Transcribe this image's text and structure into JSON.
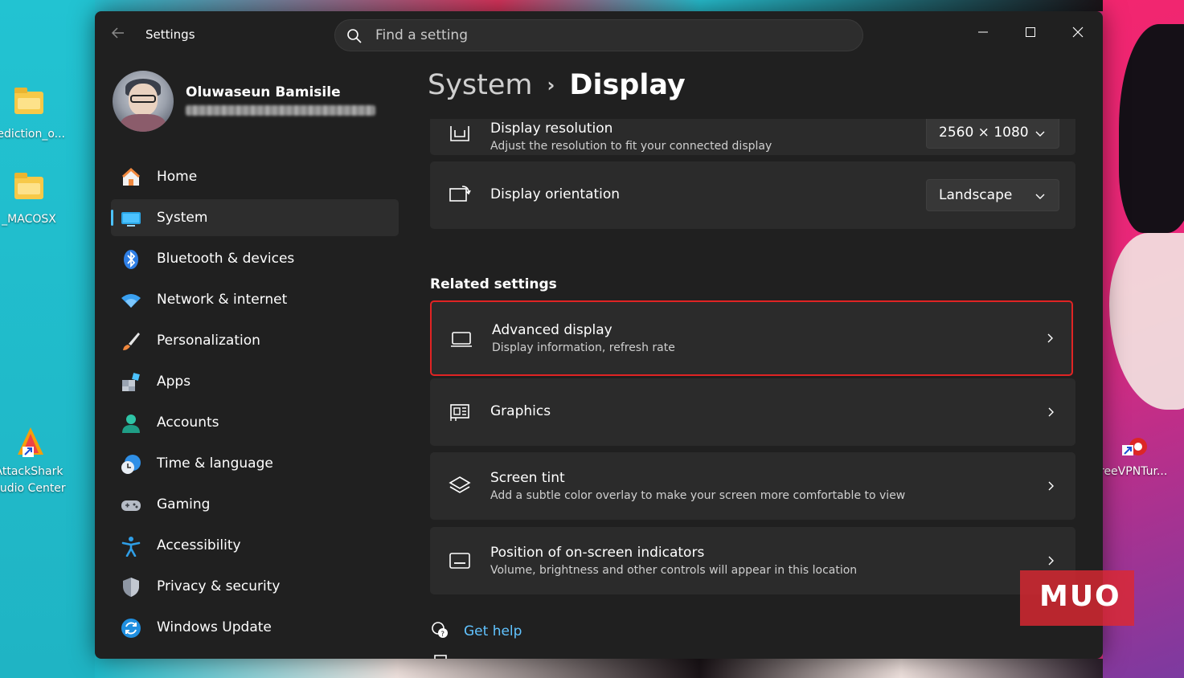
{
  "desktop": {
    "icons": [
      {
        "label": "rediction_o..."
      },
      {
        "label": "_MACOSX"
      },
      {
        "label": "AttackShark\nAudio Center"
      },
      {
        "label": "reeVPNTur..."
      }
    ],
    "watermark": "MUO"
  },
  "window": {
    "app_title": "Settings",
    "search_placeholder": "Find a setting"
  },
  "profile": {
    "name": "Oluwaseun Bamisile"
  },
  "nav": [
    {
      "label": "Home",
      "icon": "home-icon"
    },
    {
      "label": "System",
      "icon": "system-icon",
      "active": true
    },
    {
      "label": "Bluetooth & devices",
      "icon": "bluetooth-icon"
    },
    {
      "label": "Network & internet",
      "icon": "wifi-icon"
    },
    {
      "label": "Personalization",
      "icon": "brush-icon"
    },
    {
      "label": "Apps",
      "icon": "apps-icon"
    },
    {
      "label": "Accounts",
      "icon": "accounts-icon"
    },
    {
      "label": "Time & language",
      "icon": "clock-globe-icon"
    },
    {
      "label": "Gaming",
      "icon": "gamepad-icon"
    },
    {
      "label": "Accessibility",
      "icon": "accessibility-icon"
    },
    {
      "label": "Privacy & security",
      "icon": "shield-icon"
    },
    {
      "label": "Windows Update",
      "icon": "update-icon"
    }
  ],
  "breadcrumb": {
    "parent": "System",
    "separator": "›",
    "current": "Display"
  },
  "settings": {
    "resolution": {
      "title": "Display resolution",
      "subtitle": "Adjust the resolution to fit your connected display",
      "value": "2560 × 1080"
    },
    "orientation": {
      "title": "Display orientation",
      "value": "Landscape"
    },
    "related_title": "Related settings",
    "related": [
      {
        "title": "Advanced display",
        "subtitle": "Display information, refresh rate",
        "icon": "monitor-icon",
        "highlighted": true
      },
      {
        "title": "Graphics",
        "subtitle": "",
        "icon": "graphics-card-icon"
      },
      {
        "title": "Screen tint",
        "subtitle": "Add a subtle color overlay to make your screen more comfortable to view",
        "icon": "layers-icon"
      },
      {
        "title": "Position of on-screen indicators",
        "subtitle": "Volume, brightness and other controls will appear in this location",
        "icon": "indicator-position-icon"
      }
    ],
    "help_label": "Get help"
  },
  "colors": {
    "accent": "#4cc2ff",
    "highlight_border": "#e02424",
    "window_bg": "#202020",
    "card_bg": "#2b2b2b"
  }
}
